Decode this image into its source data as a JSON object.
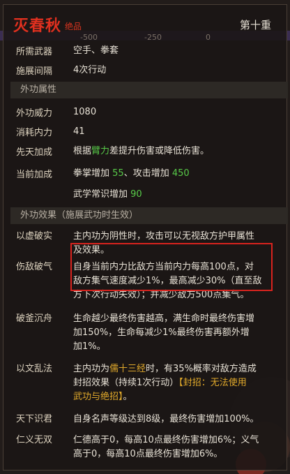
{
  "header": {
    "title": "灭春秋",
    "grade": "绝品",
    "level": "第十重"
  },
  "scale_ticks": [
    "-500",
    "-250",
    "0"
  ],
  "rows": {
    "weapon": {
      "label": "所需武器",
      "value": "空手、拳套"
    },
    "interval": {
      "label": "施展间隔",
      "value": "4次行动"
    }
  },
  "sections": {
    "outer": "外功属性",
    "effects": "外功效果（施展武功时生效）"
  },
  "stats": {
    "power": {
      "label": "外功威力",
      "value": "1080"
    },
    "cost": {
      "label": "消耗内力",
      "value": "41"
    },
    "innate": {
      "label": "先天加成",
      "pre": "根据",
      "attr": "臂力",
      "post": "差提升伤害或降低伤害。"
    },
    "current": {
      "label": "当前加成",
      "line1_a": "拳掌增加 ",
      "line1_a_val": "55",
      "line1_b": "、攻击增加 ",
      "line1_b_val": "450",
      "line2_a": "武学常识增加 ",
      "line2_a_val": "90"
    }
  },
  "effects": [
    {
      "label": "以虚破实",
      "lines": [
        "主内功为阴性时，攻击可以无视敌方护甲属性",
        "及效果。"
      ]
    },
    {
      "label": "伤敌破气",
      "lines": [
        "自身当前内力比敌方当前内力每高100点，对",
        "敌方集气速度减少1%，最高减少30%（直至敌",
        "方下次行动失效）；并减少敌方500点集气。"
      ]
    },
    {
      "label": "破釜沉舟",
      "lines": [
        "生命越少最终伤害越高，满生命时最终伤害增",
        "加150%，生命每减少1%最终伤害再额外增",
        "加1%。"
      ]
    },
    {
      "label": "以文乱法",
      "pre": "主内功为",
      "gold1": "儒十三经",
      "post1": "时，有35%概率对敌方造成",
      "line2_a": "封招效果（持续1次行动）",
      "line2_gold": "【封招：无法使用",
      "line3_gold": "武功与绝招】",
      "line3_b": "。"
    },
    {
      "label": "天下识君",
      "lines": [
        "自身名声等级达到8级，最终伤害增加100%。"
      ]
    },
    {
      "label": "仁义无双",
      "lines": [
        "仁德高于0，每高10点最终伤害增加6%；义气",
        "高于0，每高10点最终伤害增加6%。"
      ]
    }
  ]
}
